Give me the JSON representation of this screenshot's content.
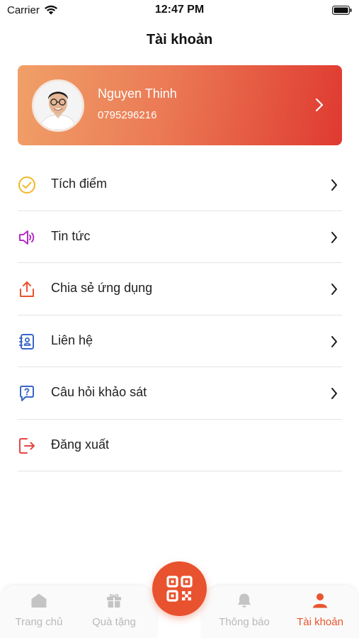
{
  "status_bar": {
    "carrier": "Carrier",
    "time": "12:47 PM"
  },
  "header": {
    "title": "Tài khoản"
  },
  "profile": {
    "name": "Nguyen Thinh",
    "phone": "0795296216"
  },
  "menu": {
    "items": [
      {
        "label": "Tích điểm",
        "icon": "check-circle-icon",
        "color": "#f2b824"
      },
      {
        "label": "Tin tức",
        "icon": "speaker-icon",
        "color": "#b130c4"
      },
      {
        "label": "Chia sẻ ứng dụng",
        "icon": "share-icon",
        "color": "#e9522f"
      },
      {
        "label": "Liên hệ",
        "icon": "contact-book-icon",
        "color": "#3a66c8"
      },
      {
        "label": "Câu hỏi khảo sát",
        "icon": "question-bubble-icon",
        "color": "#3a66c8"
      },
      {
        "label": "Đăng xuất",
        "icon": "logout-icon",
        "color": "#e54545"
      }
    ]
  },
  "tabbar": {
    "tabs": [
      {
        "label": "Trang chủ",
        "icon": "home-icon",
        "active": false
      },
      {
        "label": "Quà tặng",
        "icon": "gift-icon",
        "active": false
      },
      {
        "label": "Thông báo",
        "icon": "bell-icon",
        "active": false
      },
      {
        "label": "Tài khoản",
        "icon": "user-icon",
        "active": true
      }
    ],
    "center": {
      "icon": "qr-code-icon"
    }
  },
  "colors": {
    "accent": "#e9522f",
    "inactive": "#b9b9b9",
    "divider": "#e3e3e3"
  }
}
